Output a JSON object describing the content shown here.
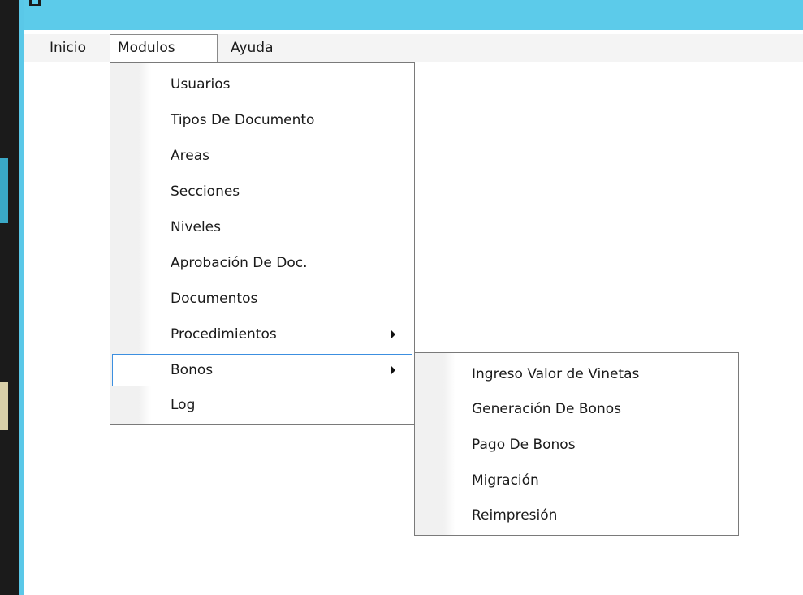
{
  "menubar": {
    "items": [
      {
        "label": "Inicio"
      },
      {
        "label": "Modulos"
      },
      {
        "label": "Ayuda"
      }
    ]
  },
  "modulos_menu": {
    "items": [
      {
        "label": "Usuarios"
      },
      {
        "label": "Tipos De Documento"
      },
      {
        "label": "Areas"
      },
      {
        "label": "Secciones"
      },
      {
        "label": "Niveles"
      },
      {
        "label": "Aprobación De Doc."
      },
      {
        "label": "Documentos"
      },
      {
        "label": "Procedimientos"
      },
      {
        "label": "Bonos"
      },
      {
        "label": "Log"
      }
    ]
  },
  "bonos_submenu": {
    "items": [
      {
        "label": "Ingreso Valor de Vinetas"
      },
      {
        "label": "Generación De Bonos"
      },
      {
        "label": "Pago De Bonos"
      },
      {
        "label": "Migración"
      },
      {
        "label": "Reimpresión"
      }
    ]
  },
  "colors": {
    "titlebar": "#5ccbea",
    "highlight_border": "#3c8fe0",
    "menubar_bg": "#f4f4f4"
  }
}
